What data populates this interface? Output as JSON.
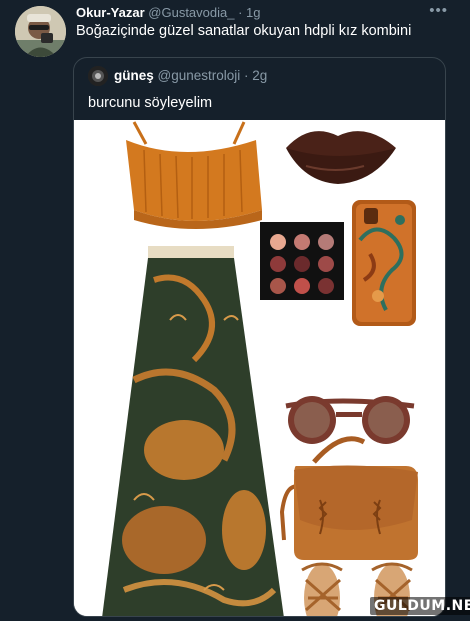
{
  "tweet": {
    "author_name": "Okur-Yazar",
    "author_handle": "@Gustavodia_",
    "separator": " · ",
    "time": "1g",
    "more_icon": "more-icon",
    "text": "Boğaziçinde güzel sanatlar okuyan hdpli kız kombini"
  },
  "quoted_tweet": {
    "author_name": "güneş",
    "author_handle": "@gunestroloji",
    "separator": " · ",
    "time": "2g",
    "text": "burcunu söyleyelim"
  },
  "image_items": [
    "orange knit crop top",
    "dark brown lipstick lips",
    "eyeshadow palette",
    "orange floral phone case",
    "patterned maxi skirt",
    "brown round sunglasses",
    "tan saddle bag",
    "lace-up sandals"
  ],
  "colors": {
    "background": "#15202b",
    "muted": "#8899a6",
    "border": "#38444d",
    "accent_orange": "#d3791f"
  },
  "watermark": "GULDUM.NET"
}
